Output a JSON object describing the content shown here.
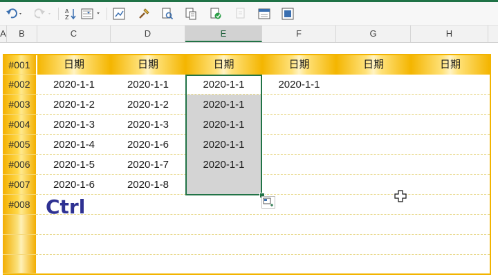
{
  "toolbar": {
    "icons": [
      "undo-icon",
      "redo-icon",
      "sort-az-icon",
      "filter-icon",
      "chart-icon",
      "format-painter-icon",
      "print-preview-icon",
      "find-icon",
      "copy-format-icon",
      "disabled-icon",
      "form-icon",
      "freeze-panes-icon"
    ]
  },
  "columns": [
    "A",
    "B",
    "C",
    "D",
    "E",
    "F",
    "G",
    "H"
  ],
  "selected_column": "E",
  "header_row": {
    "label": "#001",
    "cells": [
      "日期",
      "日期",
      "日期",
      "日期",
      "日期",
      "日期"
    ]
  },
  "rows": [
    {
      "label": "#002",
      "cells": [
        "2020-1-1",
        "2020-1-1",
        "2020-1-1",
        "2020-1-1",
        "",
        ""
      ]
    },
    {
      "label": "#003",
      "cells": [
        "2020-1-2",
        "2020-1-2",
        "2020-1-1",
        "",
        "",
        ""
      ]
    },
    {
      "label": "#004",
      "cells": [
        "2020-1-3",
        "2020-1-3",
        "2020-1-1",
        "",
        "",
        ""
      ]
    },
    {
      "label": "#005",
      "cells": [
        "2020-1-4",
        "2020-1-6",
        "2020-1-1",
        "",
        "",
        ""
      ]
    },
    {
      "label": "#006",
      "cells": [
        "2020-1-5",
        "2020-1-7",
        "2020-1-1",
        "",
        "",
        ""
      ]
    },
    {
      "label": "#007",
      "cells": [
        "2020-1-6",
        "2020-1-8",
        "",
        "",
        "",
        ""
      ]
    },
    {
      "label": "#008",
      "cells": [
        "",
        "",
        "",
        "",
        "",
        ""
      ]
    },
    {
      "label": "",
      "cells": [
        "",
        "",
        "",
        "",
        "",
        ""
      ]
    },
    {
      "label": "",
      "cells": [
        "",
        "",
        "",
        "",
        "",
        ""
      ]
    },
    {
      "label": "",
      "cells": [
        "",
        "",
        "",
        "",
        "",
        ""
      ]
    }
  ],
  "overlay_text": "Ctrl",
  "colors": {
    "accent": "#217346",
    "header_gold": "#f4b500",
    "selection_gray": "#d4d4d4",
    "overlay_text": "#2e3192"
  }
}
